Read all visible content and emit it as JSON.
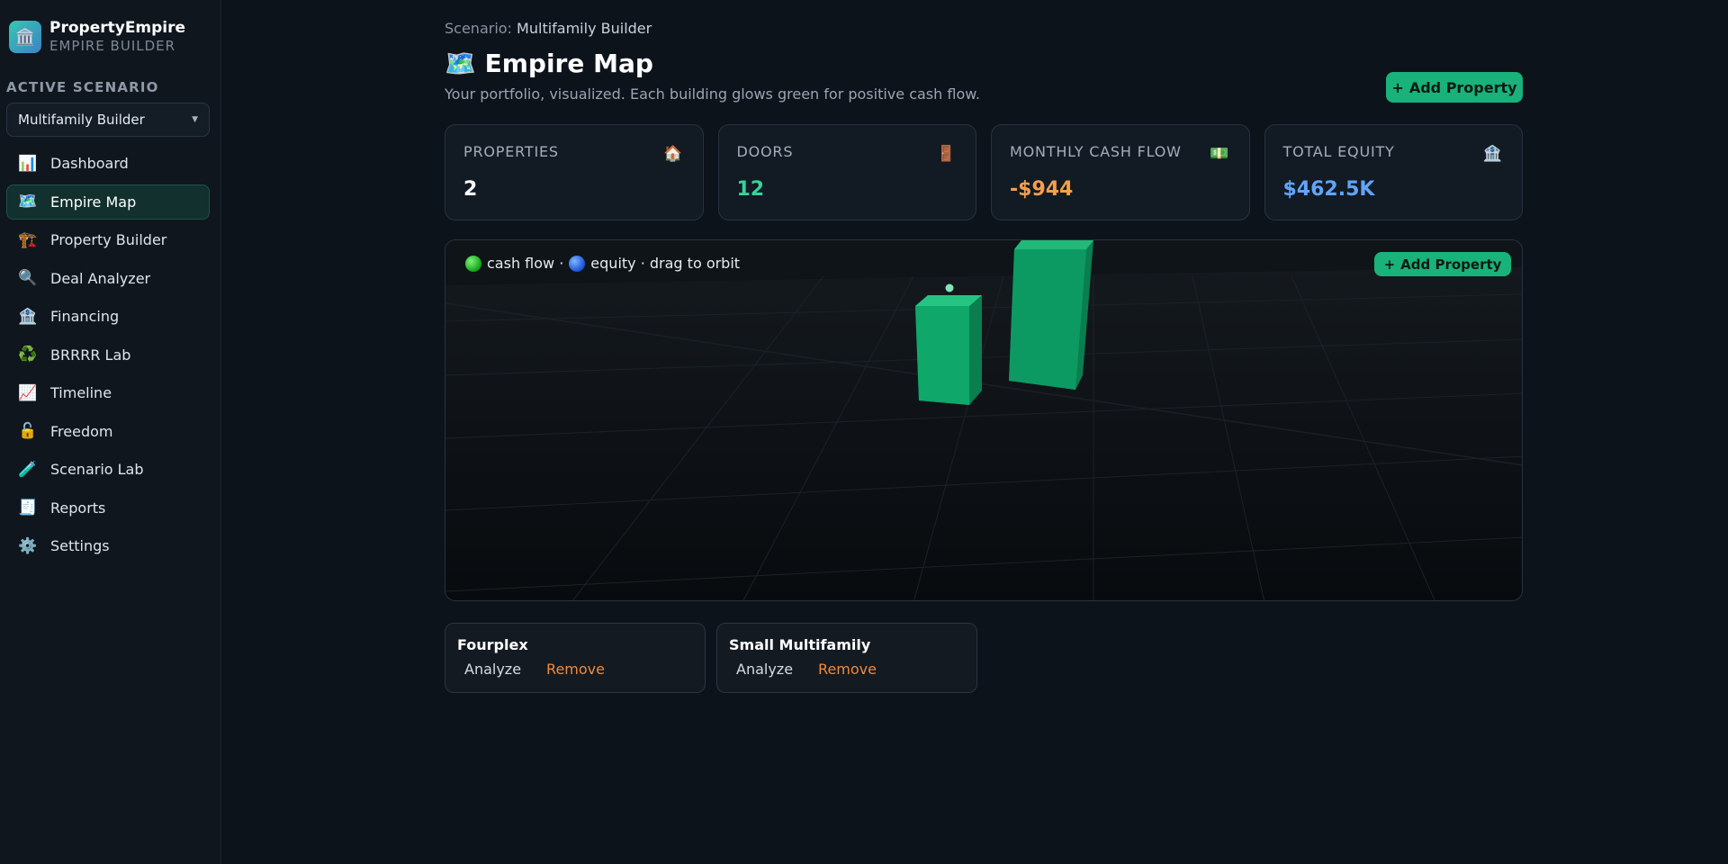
{
  "app": {
    "name": "PropertyEmpire",
    "subtitle": "EMPIRE BUILDER",
    "logo_icon": "bank-icon"
  },
  "sidebar": {
    "section_label": "ACTIVE SCENARIO",
    "scenario_value": "Multifamily Builder",
    "items": [
      {
        "label": "Dashboard",
        "icon": "📊",
        "active": false
      },
      {
        "label": "Empire Map",
        "icon": "🗺️",
        "active": true
      },
      {
        "label": "Property Builder",
        "icon": "🏗️",
        "active": false
      },
      {
        "label": "Deal Analyzer",
        "icon": "🔍",
        "active": false
      },
      {
        "label": "Financing",
        "icon": "🏦",
        "active": false
      },
      {
        "label": "BRRRR Lab",
        "icon": "♻️",
        "active": false
      },
      {
        "label": "Timeline",
        "icon": "📈",
        "active": false
      },
      {
        "label": "Freedom",
        "icon": "🔓",
        "active": false
      },
      {
        "label": "Scenario Lab",
        "icon": "🧪",
        "active": false
      },
      {
        "label": "Reports",
        "icon": "🧾",
        "active": false
      },
      {
        "label": "Settings",
        "icon": "⚙️",
        "active": false
      }
    ]
  },
  "header": {
    "crumb_label": "Scenario:",
    "crumb_value": "Multifamily Builder",
    "title": "🗺️ Empire Map",
    "subtitle": "Your portfolio, visualized. Each building glows green for positive cash flow.",
    "add_button": "Add Property"
  },
  "stats": [
    {
      "label": "PROPERTIES",
      "value": "2",
      "icon": "🏠",
      "color": "#ffffff"
    },
    {
      "label": "DOORS",
      "value": "12",
      "icon": "🚪",
      "color": "#34d399"
    },
    {
      "label": "MONTHLY CASH FLOW",
      "value": "-$944",
      "icon": "💵",
      "color": "#f59e4b"
    },
    {
      "label": "TOTAL EQUITY",
      "value": "$462.5K",
      "icon": "🏦",
      "color": "#60a5fa"
    }
  ],
  "map": {
    "legend_cash": "cash flow ·",
    "legend_equity": "equity · drag to orbit",
    "add_button": "Add Property",
    "colors": {
      "building": "#0fa86a",
      "building_side": "#0a7e4f",
      "building_top": "#26c483"
    }
  },
  "properties": [
    {
      "name": "Fourplex",
      "analyze": "Analyze",
      "remove": "Remove"
    },
    {
      "name": "Small Multifamily",
      "analyze": "Analyze",
      "remove": "Remove"
    }
  ]
}
